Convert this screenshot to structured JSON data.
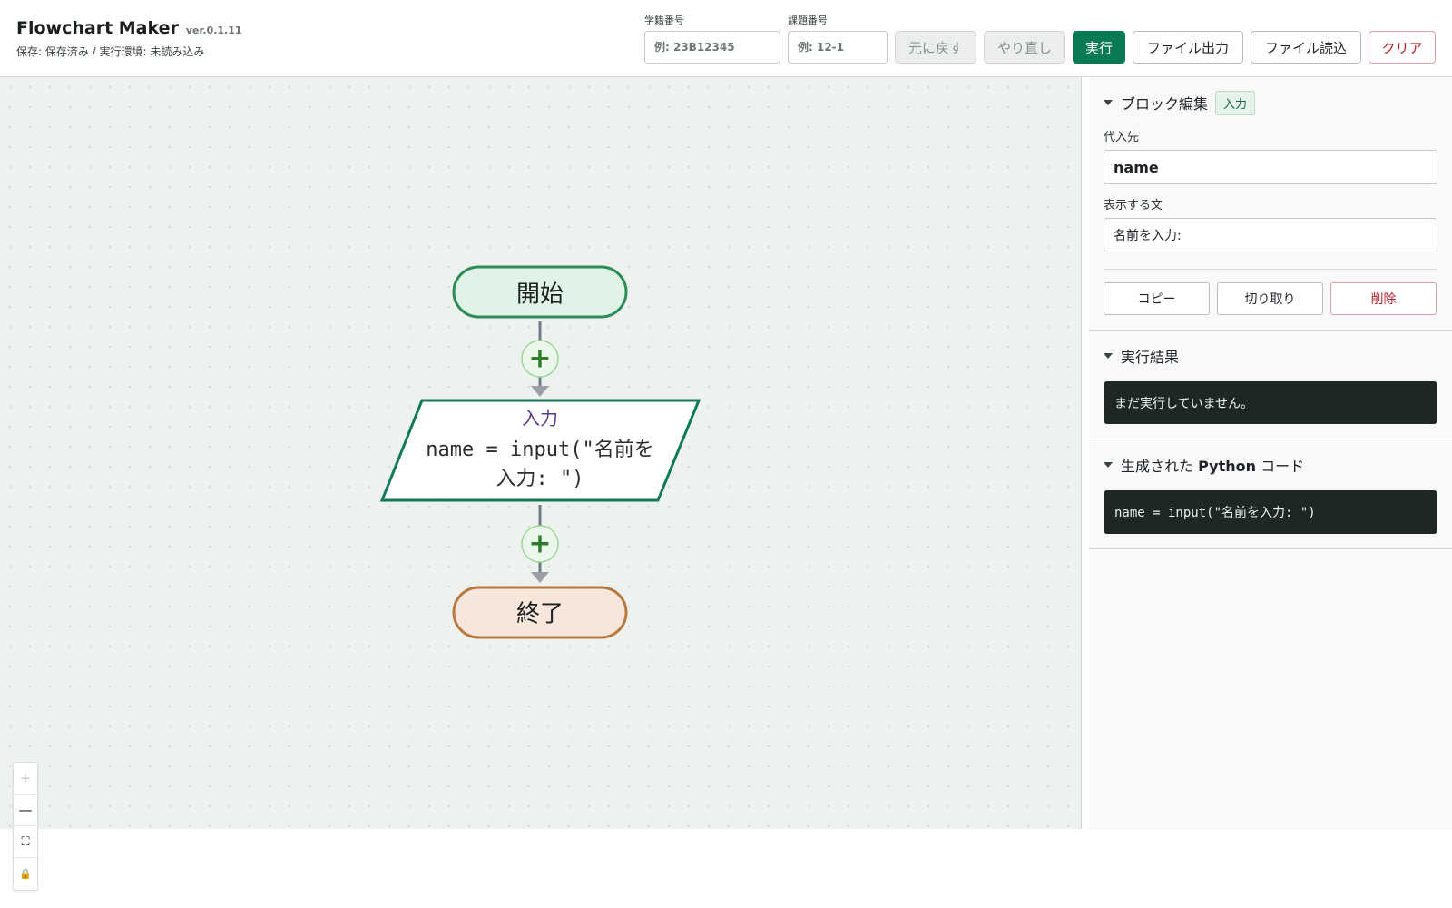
{
  "header": {
    "title": "Flowchart Maker",
    "version": "ver.0.1.11",
    "status": "保存: 保存済み / 実行環境: 未読み込み",
    "student_id_label": "学籍番号",
    "student_id_placeholder": "例: 23B12345",
    "task_id_label": "課題番号",
    "task_id_placeholder": "例: 12-1",
    "undo_label": "元に戻す",
    "redo_label": "やり直し",
    "run_label": "実行",
    "export_label": "ファイル出力",
    "import_label": "ファイル読込",
    "clear_label": "クリア"
  },
  "flowchart": {
    "start_label": "開始",
    "input_block_type": "入力",
    "input_block_line1": "name = input(\"名前を",
    "input_block_line2": "入力: \")",
    "end_label": "終了",
    "add_symbol": "+"
  },
  "zoom": {
    "zoom_in": "+",
    "zoom_out": "—",
    "fit": "⛶",
    "lock": "🔒"
  },
  "panel": {
    "block_edit": {
      "title": "ブロック編集",
      "badge": "入力",
      "target_label": "代入先",
      "target_value": "name",
      "prompt_label": "表示する文",
      "prompt_value": "名前を入力:",
      "copy_label": "コピー",
      "cut_label": "切り取り",
      "delete_label": "削除"
    },
    "result": {
      "title": "実行結果",
      "output": "まだ実行していません。"
    },
    "code": {
      "title_prefix": "生成された",
      "title_bold": "Python",
      "title_suffix": "コード",
      "content": "name = input(\"名前を入力: \")"
    }
  },
  "colors": {
    "primary": "#0a7a55",
    "danger": "#b3262d",
    "start_fill": "#dff3e6",
    "start_stroke": "#2e8b57",
    "end_fill": "#f6e6dc",
    "end_stroke": "#b8783e",
    "input_stroke": "#0f7a5a",
    "input_type_text": "#5a3d8a"
  }
}
